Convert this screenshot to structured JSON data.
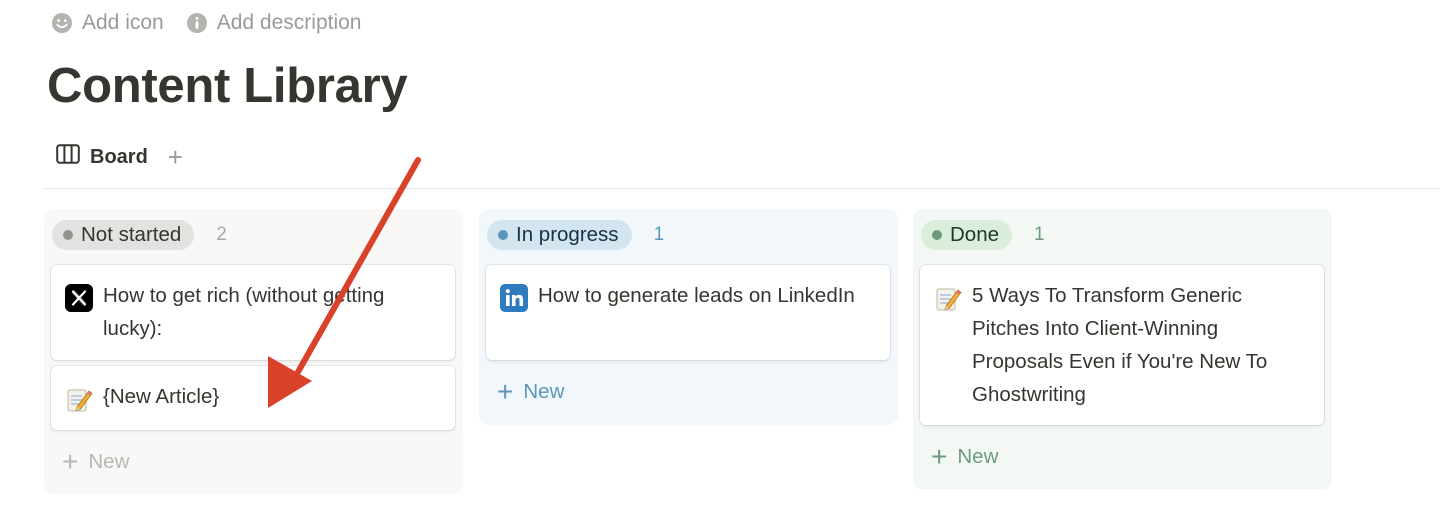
{
  "page_actions": {
    "add_icon": "Add icon",
    "add_description": "Add description"
  },
  "title": "Content Library",
  "views": {
    "board_label": "Board",
    "add_view": "+"
  },
  "columns": [
    {
      "status": "Not started",
      "count": "2",
      "cards": [
        {
          "icon": "x-logo-icon",
          "title": "How to get rich (without getting lucky):"
        },
        {
          "icon": "memo-icon",
          "title": "{New Article}"
        }
      ],
      "new_label": "New"
    },
    {
      "status": "In progress",
      "count": "1",
      "cards": [
        {
          "icon": "linkedin-icon",
          "title": "How to generate leads on LinkedIn"
        }
      ],
      "new_label": "New"
    },
    {
      "status": "Done",
      "count": "1",
      "cards": [
        {
          "icon": "memo-icon",
          "title": "5 Ways To Transform Generic Pitches Into Client-Winning Proposals Even if You're New To Ghostwriting"
        }
      ],
      "new_label": "New"
    }
  ],
  "colors": {
    "annotation_arrow": "#d9412a",
    "not_started": "#e3e2e0",
    "in_progress": "#d3e5ef",
    "done": "#dbeddb"
  }
}
